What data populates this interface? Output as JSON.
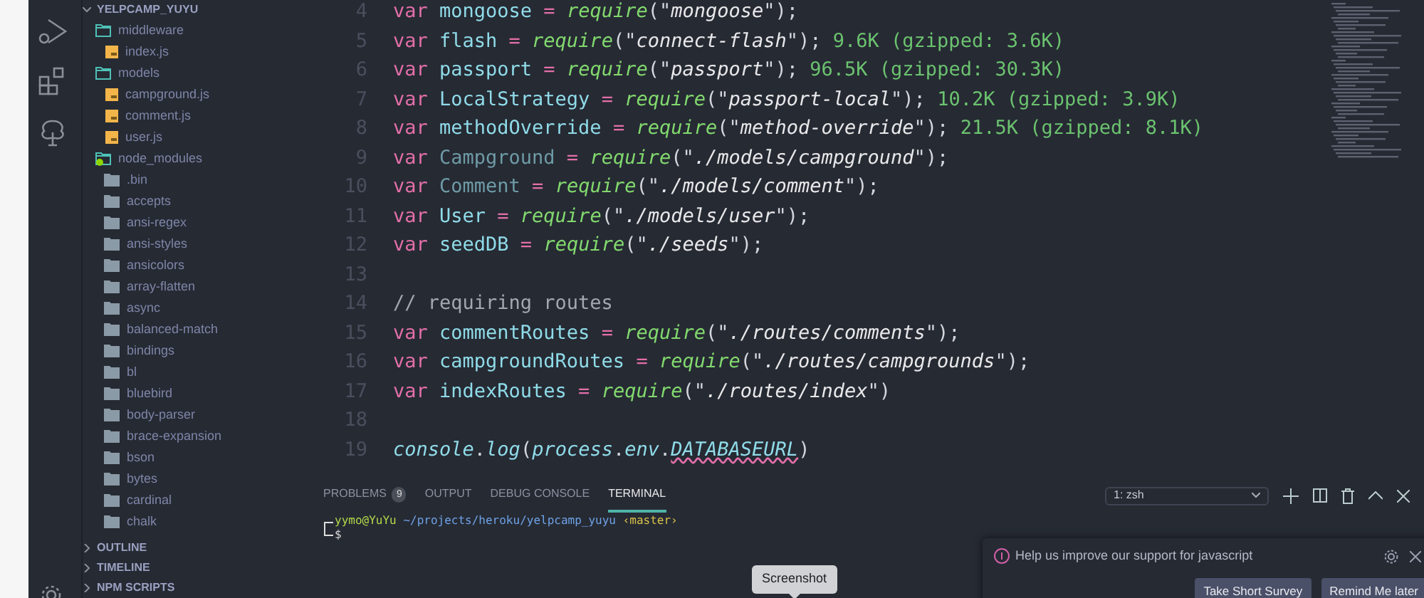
{
  "explorer": {
    "root": "YELPCAMP_YUYU",
    "tree": [
      {
        "label": "middleware",
        "kind": "folder",
        "expanded": true,
        "children": [
          {
            "label": "index.js",
            "kind": "js"
          }
        ]
      },
      {
        "label": "models",
        "kind": "folder",
        "expanded": true,
        "children": [
          {
            "label": "campground.js",
            "kind": "js"
          },
          {
            "label": "comment.js",
            "kind": "js"
          },
          {
            "label": "user.js",
            "kind": "js"
          }
        ]
      },
      {
        "label": "node_modules",
        "kind": "folder",
        "expanded": true,
        "decorated": true,
        "children": [
          {
            "label": ".bin",
            "kind": "folder",
            "expanded": false
          },
          {
            "label": "accepts",
            "kind": "folder",
            "expanded": false
          },
          {
            "label": "ansi-regex",
            "kind": "folder",
            "expanded": false
          },
          {
            "label": "ansi-styles",
            "kind": "folder",
            "expanded": false
          },
          {
            "label": "ansicolors",
            "kind": "folder",
            "expanded": false
          },
          {
            "label": "array-flatten",
            "kind": "folder",
            "expanded": false
          },
          {
            "label": "async",
            "kind": "folder",
            "expanded": false
          },
          {
            "label": "balanced-match",
            "kind": "folder",
            "expanded": false
          },
          {
            "label": "bindings",
            "kind": "folder",
            "expanded": false
          },
          {
            "label": "bl",
            "kind": "folder",
            "expanded": false
          },
          {
            "label": "bluebird",
            "kind": "folder",
            "expanded": false
          },
          {
            "label": "body-parser",
            "kind": "folder",
            "expanded": false
          },
          {
            "label": "brace-expansion",
            "kind": "folder",
            "expanded": false
          },
          {
            "label": "bson",
            "kind": "folder",
            "expanded": false
          },
          {
            "label": "bytes",
            "kind": "folder",
            "expanded": false
          },
          {
            "label": "cardinal",
            "kind": "folder",
            "expanded": false
          },
          {
            "label": "chalk",
            "kind": "folder",
            "expanded": false
          }
        ]
      }
    ],
    "sections": [
      {
        "label": "OUTLINE",
        "expanded": false
      },
      {
        "label": "TIMELINE",
        "expanded": false
      },
      {
        "label": "NPM SCRIPTS",
        "expanded": false
      }
    ]
  },
  "editor": {
    "lines": [
      {
        "number": "4",
        "tokens": [
          {
            "kind": "kw",
            "text": "var "
          },
          {
            "kind": "var",
            "text": "mongoose"
          },
          {
            "kind": "op",
            "text": " = "
          },
          {
            "kind": "fn",
            "text": "require"
          },
          {
            "kind": "punct",
            "text": "(\""
          },
          {
            "kind": "str",
            "text": "mongoose"
          },
          {
            "kind": "punct",
            "text": "\");"
          }
        ]
      },
      {
        "number": "5",
        "tokens": [
          {
            "kind": "kw",
            "text": "var "
          },
          {
            "kind": "var",
            "text": "flash"
          },
          {
            "kind": "op",
            "text": " = "
          },
          {
            "kind": "fn",
            "text": "require"
          },
          {
            "kind": "punct",
            "text": "(\""
          },
          {
            "kind": "str",
            "text": "connect-flash"
          },
          {
            "kind": "punct",
            "text": "\");"
          },
          {
            "kind": "size",
            "text": " 9.6K (gzipped: 3.6K)"
          }
        ]
      },
      {
        "number": "6",
        "tokens": [
          {
            "kind": "kw",
            "text": "var "
          },
          {
            "kind": "var",
            "text": "passport"
          },
          {
            "kind": "op",
            "text": " = "
          },
          {
            "kind": "fn",
            "text": "require"
          },
          {
            "kind": "punct",
            "text": "(\""
          },
          {
            "kind": "str",
            "text": "passport"
          },
          {
            "kind": "punct",
            "text": "\");"
          },
          {
            "kind": "size",
            "text": " 96.5K (gzipped: 30.3K)"
          }
        ]
      },
      {
        "number": "7",
        "tokens": [
          {
            "kind": "kw",
            "text": "var "
          },
          {
            "kind": "var",
            "text": "LocalStrategy"
          },
          {
            "kind": "op",
            "text": " = "
          },
          {
            "kind": "fn",
            "text": "require"
          },
          {
            "kind": "punct",
            "text": "(\""
          },
          {
            "kind": "str",
            "text": "passport-local"
          },
          {
            "kind": "punct",
            "text": "\");"
          },
          {
            "kind": "size",
            "text": " 10.2K (gzipped: 3.9K)"
          }
        ]
      },
      {
        "number": "8",
        "tokens": [
          {
            "kind": "kw",
            "text": "var "
          },
          {
            "kind": "var",
            "text": "methodOverride"
          },
          {
            "kind": "op",
            "text": " = "
          },
          {
            "kind": "fn",
            "text": "require"
          },
          {
            "kind": "punct",
            "text": "(\""
          },
          {
            "kind": "str",
            "text": "method-override"
          },
          {
            "kind": "punct",
            "text": "\");"
          },
          {
            "kind": "size",
            "text": " 21.5K (gzipped: 8.1K)"
          }
        ]
      },
      {
        "number": "9",
        "tokens": [
          {
            "kind": "kw",
            "text": "var "
          },
          {
            "kind": "unused",
            "text": "Campground"
          },
          {
            "kind": "op",
            "text": " = "
          },
          {
            "kind": "fn",
            "text": "require"
          },
          {
            "kind": "punct",
            "text": "(\""
          },
          {
            "kind": "str",
            "text": "./models/campground"
          },
          {
            "kind": "punct",
            "text": "\");"
          }
        ]
      },
      {
        "number": "10",
        "tokens": [
          {
            "kind": "kw",
            "text": "var "
          },
          {
            "kind": "unused",
            "text": "Comment"
          },
          {
            "kind": "op",
            "text": " = "
          },
          {
            "kind": "fn",
            "text": "require"
          },
          {
            "kind": "punct",
            "text": "(\""
          },
          {
            "kind": "str",
            "text": "./models/comment"
          },
          {
            "kind": "punct",
            "text": "\");"
          }
        ]
      },
      {
        "number": "11",
        "tokens": [
          {
            "kind": "kw",
            "text": "var "
          },
          {
            "kind": "var",
            "text": "User"
          },
          {
            "kind": "op",
            "text": " = "
          },
          {
            "kind": "fn",
            "text": "require"
          },
          {
            "kind": "punct",
            "text": "(\""
          },
          {
            "kind": "str",
            "text": "./models/user"
          },
          {
            "kind": "punct",
            "text": "\");"
          }
        ]
      },
      {
        "number": "12",
        "tokens": [
          {
            "kind": "kw",
            "text": "var "
          },
          {
            "kind": "var",
            "text": "seedDB"
          },
          {
            "kind": "op",
            "text": " = "
          },
          {
            "kind": "fn",
            "text": "require"
          },
          {
            "kind": "punct",
            "text": "(\""
          },
          {
            "kind": "str",
            "text": "./seeds"
          },
          {
            "kind": "punct",
            "text": "\");"
          }
        ]
      },
      {
        "number": "13"
      },
      {
        "number": "14",
        "tokens": [
          {
            "kind": "comment",
            "text": "// requiring routes"
          }
        ]
      },
      {
        "number": "15",
        "tokens": [
          {
            "kind": "kw",
            "text": "var "
          },
          {
            "kind": "var",
            "text": "commentRoutes"
          },
          {
            "kind": "op",
            "text": " = "
          },
          {
            "kind": "fn",
            "text": "require"
          },
          {
            "kind": "punct",
            "text": "(\""
          },
          {
            "kind": "str",
            "text": "./routes/comments"
          },
          {
            "kind": "punct",
            "text": "\");"
          }
        ]
      },
      {
        "number": "16",
        "tokens": [
          {
            "kind": "kw",
            "text": "var "
          },
          {
            "kind": "var",
            "text": "campgroundRoutes"
          },
          {
            "kind": "op",
            "text": " = "
          },
          {
            "kind": "fn",
            "text": "require"
          },
          {
            "kind": "punct",
            "text": "(\""
          },
          {
            "kind": "str",
            "text": "./routes/campgrounds"
          },
          {
            "kind": "punct",
            "text": "\");"
          }
        ]
      },
      {
        "number": "17",
        "tokens": [
          {
            "kind": "kw",
            "text": "var "
          },
          {
            "kind": "var",
            "text": "indexRoutes"
          },
          {
            "kind": "op",
            "text": " = "
          },
          {
            "kind": "fn",
            "text": "require"
          },
          {
            "kind": "punct",
            "text": "(\""
          },
          {
            "kind": "str",
            "text": "./routes/index"
          },
          {
            "kind": "punct",
            "text": "\")"
          }
        ]
      },
      {
        "number": "18"
      },
      {
        "number": "19",
        "tokens": [
          {
            "kind": "obj",
            "text": "console"
          },
          {
            "kind": "punct",
            "text": "."
          },
          {
            "kind": "obj",
            "text": "log"
          },
          {
            "kind": "punct",
            "text": "("
          },
          {
            "kind": "obj",
            "text": "process"
          },
          {
            "kind": "punct",
            "text": "."
          },
          {
            "kind": "obj",
            "text": "env"
          },
          {
            "kind": "punct",
            "text": "."
          },
          {
            "kind": "error",
            "text": "DATABASEURL"
          },
          {
            "kind": "punct",
            "text": ")"
          }
        ]
      }
    ]
  },
  "panel": {
    "tabs": [
      {
        "label": "PROBLEMS",
        "badge": "9",
        "selected": false
      },
      {
        "label": "OUTPUT",
        "selected": false
      },
      {
        "label": "DEBUG CONSOLE",
        "selected": false
      },
      {
        "label": "TERMINAL",
        "selected": true
      }
    ],
    "terminal_select": "1: zsh",
    "terminal": {
      "user": "yymo@YuYu",
      "path": "~/projects/heroku/yelpcamp_yuyu",
      "branch": "‹master›",
      "prompt": "$"
    }
  },
  "notification": {
    "message": "Help us improve our support for javascript",
    "buttons": [
      "Take Short Survey",
      "Remind Me later"
    ]
  },
  "tooltip": "Screenshot"
}
